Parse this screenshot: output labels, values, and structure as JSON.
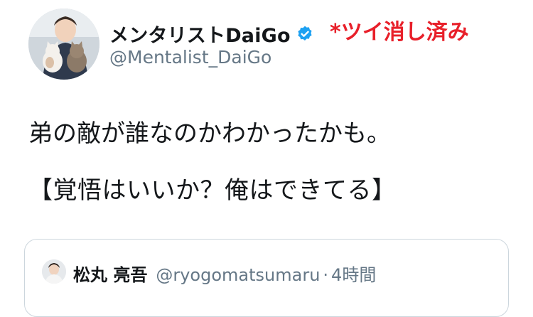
{
  "author": {
    "display_name": "メンタリストDaiGo",
    "handle": "@Mentalist_DaiGo",
    "verified": true,
    "avatar_icon": "profile-photo-with-cats"
  },
  "annotation": {
    "text": "*ツイ消し済み",
    "color": "#e8202a"
  },
  "tweet": {
    "lines": [
      "弟の敵が誰なのかわかったかも。",
      "【覚悟はいいか？俺はできてる】"
    ]
  },
  "quoted_tweet": {
    "display_name": "松丸 亮吾",
    "handle": "@ryogomatsumaru",
    "separator": "·",
    "time": "4時間"
  },
  "colors": {
    "verified_badge": "#1da1f2",
    "secondary_text": "#657786",
    "card_border": "#ccd6dd"
  }
}
